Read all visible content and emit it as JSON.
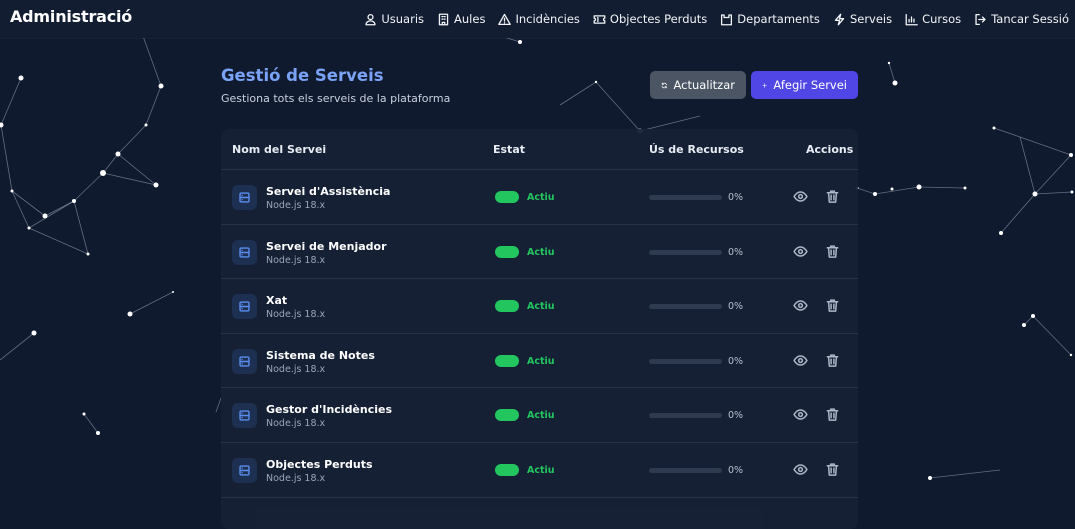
{
  "app_title": "Administració",
  "nav": [
    {
      "label": "Usuaris",
      "icon": "user-icon"
    },
    {
      "label": "Aules",
      "icon": "building-icon"
    },
    {
      "label": "Incidències",
      "icon": "warning-icon"
    },
    {
      "label": "Objectes Perduts",
      "icon": "ticket-icon"
    },
    {
      "label": "Departaments",
      "icon": "inbox-icon"
    },
    {
      "label": "Serveis",
      "icon": "bolt-icon"
    },
    {
      "label": "Cursos",
      "icon": "chart-icon"
    },
    {
      "label": "Tancar Sessió",
      "icon": "logout-icon"
    }
  ],
  "page": {
    "title": "Gestió de Serveis",
    "subtitle": "Gestiona tots els serveis de la plataforma",
    "refresh_label": "Actualitzar",
    "add_label": "Afegir Servei"
  },
  "table": {
    "headers": {
      "name": "Nom del Servei",
      "status": "Estat",
      "usage": "Ús de Recursos",
      "actions": "Accions"
    },
    "rows": [
      {
        "name": "Servei d'Assistència",
        "runtime": "Node.js 18.x",
        "status": "Actiu",
        "usage_label": "0%",
        "usage": 0
      },
      {
        "name": "Servei de Menjador",
        "runtime": "Node.js 18.x",
        "status": "Actiu",
        "usage_label": "0%",
        "usage": 0
      },
      {
        "name": "Xat",
        "runtime": "Node.js 18.x",
        "status": "Actiu",
        "usage_label": "0%",
        "usage": 0
      },
      {
        "name": "Sistema de Notes",
        "runtime": "Node.js 18.x",
        "status": "Actiu",
        "usage_label": "0%",
        "usage": 0
      },
      {
        "name": "Gestor d'Incidències",
        "runtime": "Node.js 18.x",
        "status": "Actiu",
        "usage_label": "0%",
        "usage": 0
      },
      {
        "name": "Objectes Perduts",
        "runtime": "Node.js 18.x",
        "status": "Actiu",
        "usage_label": "0%",
        "usage": 0
      }
    ]
  },
  "colors": {
    "background": "#0f1a2e",
    "accent_title": "#7aa2f7",
    "primary_button": "#4f46e5",
    "secondary_button": "#4b5563",
    "status_active": "#22c55e"
  }
}
